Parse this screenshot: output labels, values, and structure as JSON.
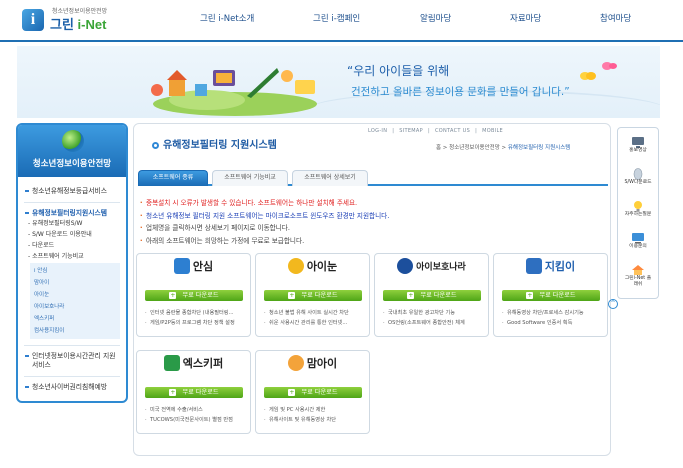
{
  "header": {
    "logo_sub": "청소년정보이용안전망",
    "logo_main_prefix": "그린",
    "logo_main_suffix": "i-Net",
    "nav": [
      "그린 i-Net소개",
      "그린 i-캠페인",
      "알림마당",
      "자료마당",
      "참여마당"
    ]
  },
  "banner": {
    "quote_line1": "“우리 아이들을 위해",
    "quote_line2": "건전하고 올바른 정보이용 문화를 만들어 갑니다.”"
  },
  "sidebar": {
    "title": "청소년정보이용안전망",
    "items": [
      {
        "label": "청소년유해정보등급서비스"
      },
      {
        "label": "유해정보필터링지원시스템"
      },
      {
        "label": "인터넷정보이용시간관리 지원서비스"
      },
      {
        "label": "청소년사이버권리침해예방"
      }
    ],
    "sub_items": [
      "- 유해정보필터링S/W",
      "- S/W 다운로드 이용안내",
      "- 다운로드",
      "- 소프트웨어 기능비교"
    ],
    "sub_sub_items": [
      "i 안심",
      "맘아이",
      "아이눈",
      "아이보호나라",
      "엑스키퍼",
      "컴사용지킴이"
    ]
  },
  "content": {
    "top_links": [
      "LOG-IN",
      "|",
      "SITEMAP",
      "|",
      "CONTACT US",
      "|",
      "MOBILE"
    ],
    "title": "유해정보필터링 지원시스템",
    "breadcrumb_prefix": "홈 > 청소년정보이용안전망 > ",
    "breadcrumb_current": "유해정보필터링 지원시스템",
    "tabs": [
      "소프트웨어 종류",
      "소프트웨어 기능비교",
      "소프트웨어 상세보기"
    ],
    "notes": [
      "중복설치 시 오류가 발생할 수 있습니다. 소프트웨어는 하나만 설치해 주세요.",
      "청소년 유해정보 필터링 지원 소프트웨어는 마이크로소프트 윈도우즈 환경만 지원합니다.",
      "업체명을 클릭하시면 상세보기 페이지로 이동합니다.",
      "아래의 소프트웨어는 희망하는 가정에 무료로 보급합니다."
    ],
    "download_label": "무료 다운로드",
    "cards": [
      {
        "name": "안심",
        "desc": [
          "인터넷 음란물 종합차단 (내용필터링...",
          "게임/P2P등의 프로그램 차단 정책 설정"
        ]
      },
      {
        "name": "아이눈",
        "desc": [
          "청소년 불법 유해 사이트 실시간 차단",
          "쉬운 사용시간 관리를 통한 인터넷..."
        ]
      },
      {
        "name": "아이보호나라",
        "desc": [
          "국내최초 유일한 광고차단 기능",
          "OS언링(소프트웨어 종합안전) 체계"
        ]
      },
      {
        "name": "지킴이",
        "desc": [
          "유해동영상 차단/프로세스 감시기능",
          "Good Software 인증서 획득"
        ]
      },
      {
        "name": "엑스키퍼",
        "desc": [
          "미국 전역에 수출/서비스",
          "TUCOWS(미국전문사이트) 별점 만점"
        ]
      },
      {
        "name": "맘아이",
        "desc": [
          "게임 및 PC 사용시간 제한",
          "유해사이트 및 유해동영상 차단"
        ]
      }
    ]
  },
  "quick_menu": [
    {
      "label": "홍보영상"
    },
    {
      "label": "S/W다운로드"
    },
    {
      "label": "자주하는질문"
    },
    {
      "label": "이용문의"
    },
    {
      "label": "그린i-Net 플래쉬"
    }
  ],
  "colors": {
    "primary_blue": "#1f6fb3",
    "tab_blue": "#2e8ad2",
    "download_green": "#4ea517",
    "warning_red": "#e02020",
    "notice_blue": "#1b3fb6"
  }
}
